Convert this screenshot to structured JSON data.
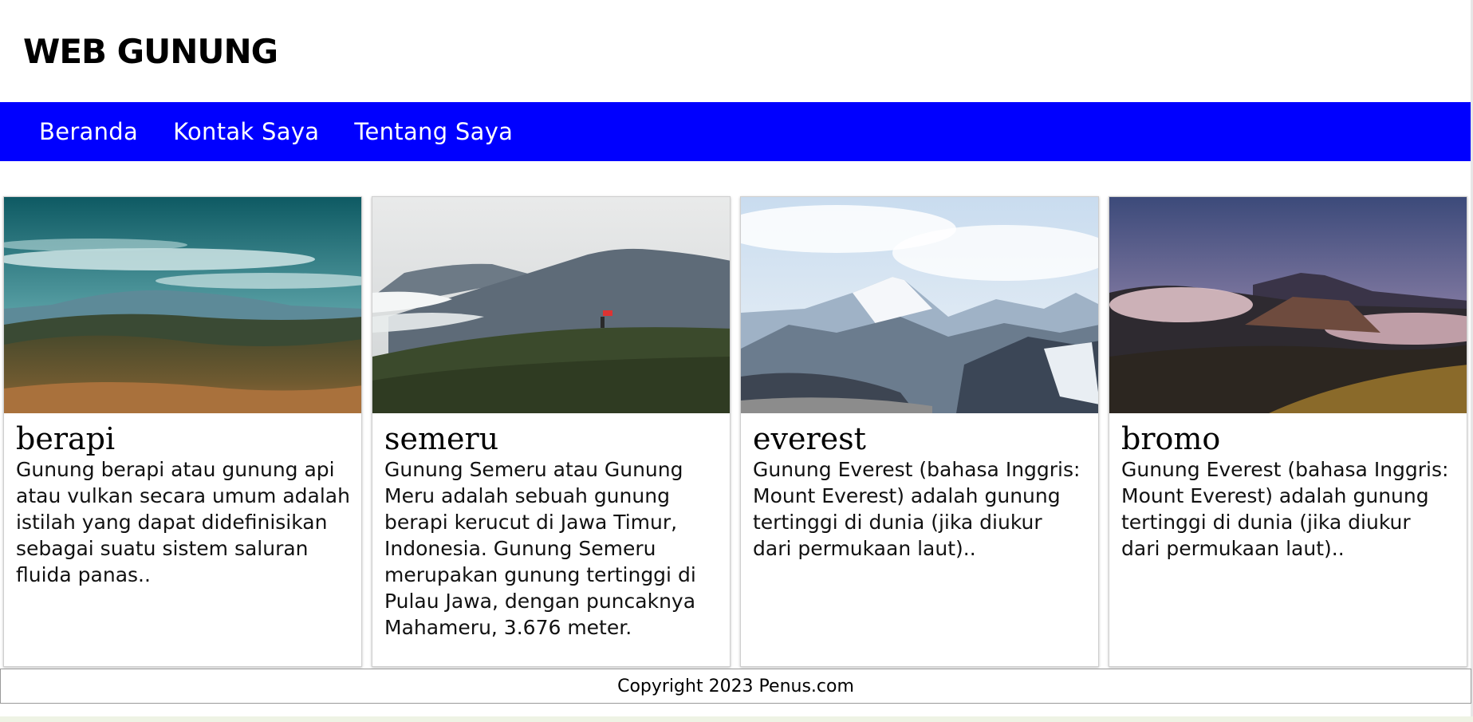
{
  "site": {
    "title": "WEB GUNUNG"
  },
  "nav": {
    "items": [
      {
        "label": "Beranda"
      },
      {
        "label": "Kontak Saya"
      },
      {
        "label": "Tentang Saya"
      }
    ]
  },
  "cards": [
    {
      "title": "berapi",
      "text": "Gunung berapi atau gunung api atau vulkan secara umum adalah istilah yang dapat didefinisikan sebagai suatu sistem saluran fluida panas..",
      "image": "green-hills-mountain-photo"
    },
    {
      "title": "semeru",
      "text": "Gunung Semeru atau Gunung Meru adalah sebuah gunung berapi kerucut di Jawa Timur, Indonesia. Gunung Semeru merupakan gunung tertinggi di Pulau Jawa, dengan puncaknya Mahameru, 3.676 meter.",
      "image": "semeru-hiker-photo"
    },
    {
      "title": "everest",
      "text": "Gunung Everest (bahasa Inggris: Mount Everest) adalah gunung tertinggi di dunia (jika diukur dari permukaan laut)..",
      "image": "snowy-peaks-photo"
    },
    {
      "title": "bromo",
      "text": "Gunung Everest (bahasa Inggris: Mount Everest) adalah gunung tertinggi di dunia (jika diukur dari permukaan laut)..",
      "image": "bromo-caldera-photo"
    }
  ],
  "footer": {
    "text": "Copyright 2023 Penus.com"
  },
  "colors": {
    "nav_bg": "#0000ff",
    "nav_text": "#ffffff",
    "page_bg": "#ffffff"
  }
}
